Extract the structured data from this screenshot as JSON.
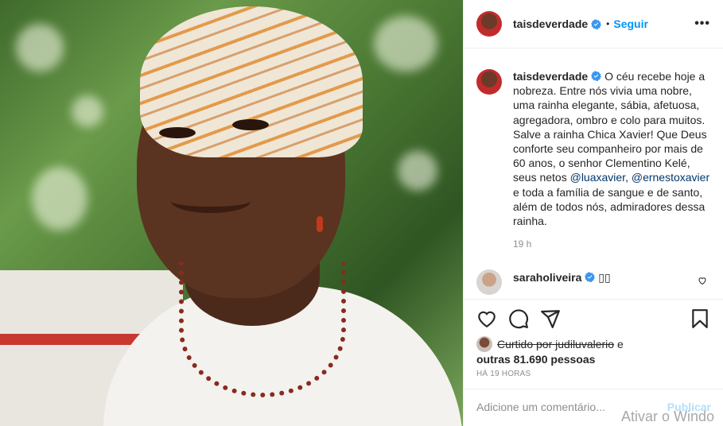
{
  "post": {
    "username": "taisdeverdade",
    "follow_label": "Seguir",
    "separator": "•",
    "more_label": "•••"
  },
  "caption": {
    "username": "taisdeverdade",
    "text_before": "O céu recebe hoje a nobreza. Entre nós vivia uma nobre, uma rainha elegante, sábia, afetuosa, agregadora, ombro e colo para muitos. Salve a rainha Chica Xavier! Que Deus conforte seu companheiro por mais de 60 anos, o senhor Clementino Kelé, seus netos",
    "mention1": "@luaxavier",
    "comma": ",",
    "mention2": "@ernestoxavier",
    "text_after": "e toda a família de sangue e de santo, além de todos nós, admiradores dessa rainha.",
    "time_ago": "19 h"
  },
  "comment": {
    "username": "saraholiveira",
    "text": "▯▯"
  },
  "likes": {
    "liked_by": "Curtido por judiluvalerio",
    "conjunction": "e",
    "count_text": "outras 81.690 pessoas"
  },
  "posted_ago": "HÁ 19 HORAS",
  "comment_box": {
    "placeholder": "Adicione um comentário...",
    "publish_label": "Publicar"
  },
  "watermark": "Ativar o Windo",
  "colors": {
    "accent": "#0095f6",
    "mention": "#00376b",
    "muted": "#8e8e8e"
  }
}
